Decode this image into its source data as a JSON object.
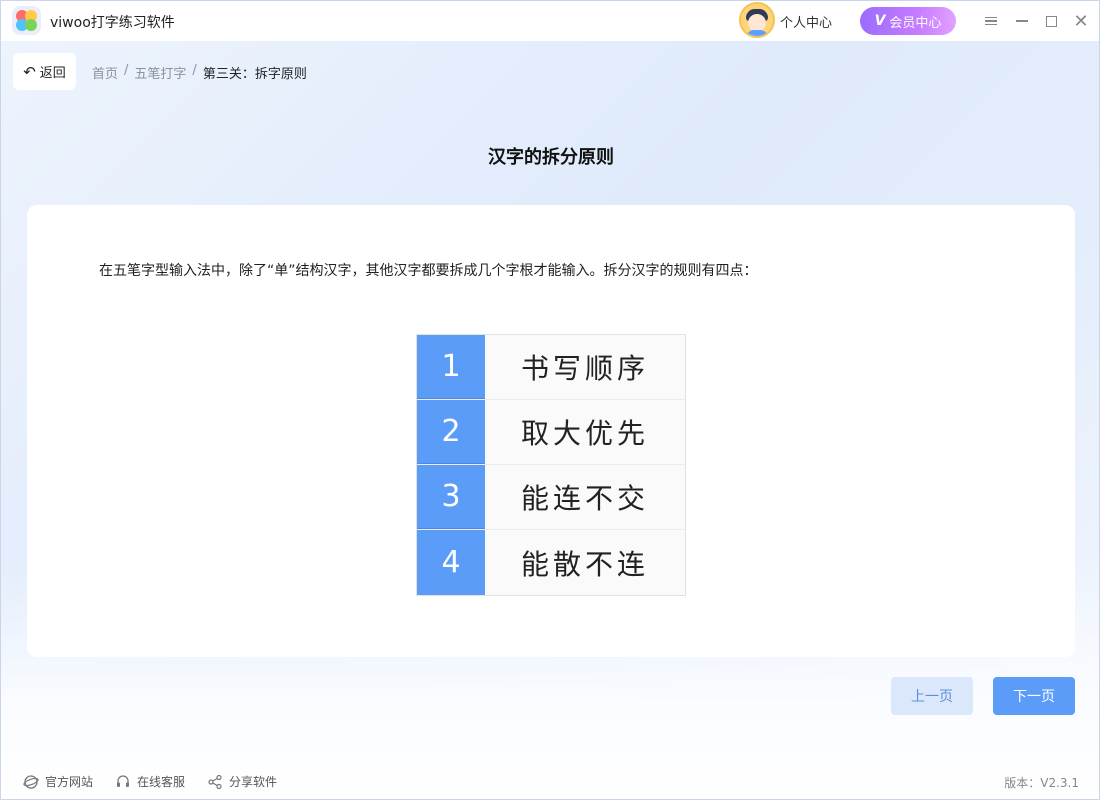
{
  "app": {
    "title": "viwoo打字练习软件"
  },
  "header": {
    "profile_label": "个人中心",
    "vip_label": "会员中心"
  },
  "nav": {
    "back_label": "返回",
    "breadcrumb": [
      "首页",
      "五笔打字",
      "第三关：拆字原则"
    ]
  },
  "main": {
    "title": "汉字的拆分原则",
    "intro": "在五笔字型输入法中，除了“单”结构汉字，其他汉字都要拆成几个字根才能输入。拆分汉字的规则有四点：",
    "rules": [
      {
        "num": "1",
        "text": "书写顺序"
      },
      {
        "num": "2",
        "text": "取大优先"
      },
      {
        "num": "3",
        "text": "能连不交"
      },
      {
        "num": "4",
        "text": "能散不连"
      }
    ]
  },
  "pager": {
    "prev_label": "上一页",
    "next_label": "下一页"
  },
  "footer": {
    "website_label": "官方网站",
    "support_label": "在线客服",
    "share_label": "分享软件",
    "version": "版本：V2.3.1"
  },
  "colors": {
    "accent": "#5b9cf8",
    "vip_start": "#9b6cff",
    "vip_end": "#e3a1ff"
  }
}
